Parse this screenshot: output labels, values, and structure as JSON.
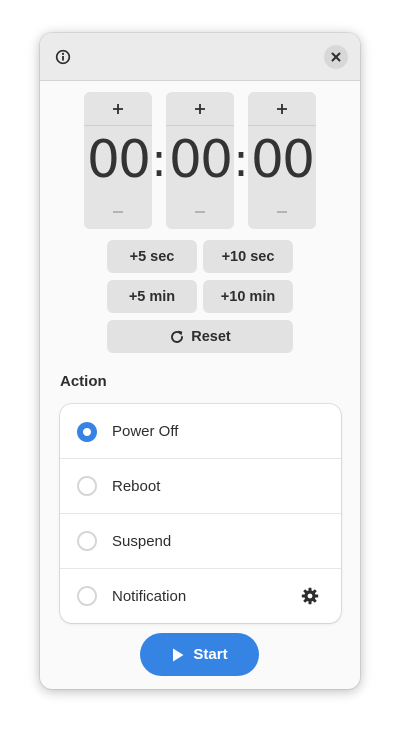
{
  "header": {
    "info_icon": "info-icon",
    "close_icon": "close-icon"
  },
  "timer": {
    "hours": "00",
    "minutes": "00",
    "seconds": "00",
    "separator": ":",
    "increment_label": "+",
    "decrement_label": "–"
  },
  "quick_add": {
    "plus_5_sec": "+5 sec",
    "plus_10_sec": "+10 sec",
    "plus_5_min": "+5 min",
    "plus_10_min": "+10 min",
    "reset": "Reset",
    "reset_icon": "refresh-icon"
  },
  "action": {
    "title": "Action",
    "options": [
      {
        "label": "Power Off",
        "selected": true
      },
      {
        "label": "Reboot",
        "selected": false
      },
      {
        "label": "Suspend",
        "selected": false
      },
      {
        "label": "Notification",
        "selected": false
      }
    ],
    "settings_icon": "gear-icon"
  },
  "start": {
    "label": "Start",
    "icon": "play-icon"
  },
  "colors": {
    "accent": "#3584e4",
    "window_bg": "#fafafa",
    "headerbar_bg": "#ebebeb",
    "button_bg": "#e2e2e2"
  }
}
